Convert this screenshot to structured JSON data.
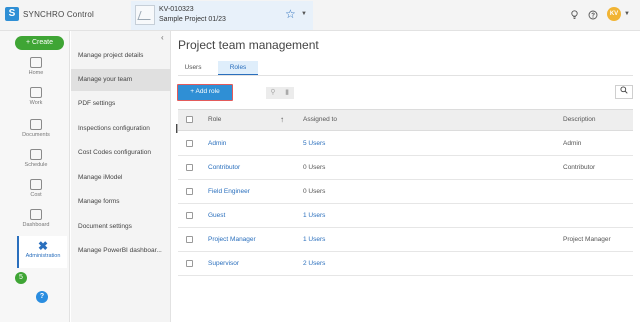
{
  "topbar": {
    "app_logo_glyph": "S",
    "app_title": "SYNCHRO Control",
    "project_code": "KV-010323",
    "project_name": "Sample Project 01/23",
    "favorite_icon": "star-outline-icon",
    "user_initials": "KV",
    "icons": [
      "lightbulb-icon",
      "help-circle-icon"
    ]
  },
  "leftrail": {
    "create_label": "+ Create",
    "items": [
      {
        "label": "Home",
        "icon": "home-icon"
      },
      {
        "label": "Work",
        "icon": "work-icon"
      },
      {
        "label": "Documents",
        "icon": "document-icon"
      },
      {
        "label": "Schedule",
        "icon": "schedule-icon"
      },
      {
        "label": "Cost",
        "icon": "cost-icon"
      },
      {
        "label": "Dashboard",
        "icon": "dashboard-icon"
      }
    ],
    "active_item": {
      "label": "Administration",
      "icon": "administration-icon"
    },
    "notification_count": "5",
    "help_label": "?"
  },
  "submenu": {
    "items": [
      "Manage project details",
      "Manage your team",
      "PDF settings",
      "Inspections configuration",
      "Cost Codes configuration",
      "Manage iModel",
      "Manage forms",
      "Document settings",
      "Manage PowerBI dashboar..."
    ],
    "active_index": 1
  },
  "main": {
    "title": "Project team management",
    "tabs": [
      {
        "label": "Users",
        "active": false
      },
      {
        "label": "Roles",
        "active": true
      }
    ],
    "add_role_label": "+ Add role",
    "columns": {
      "role": "Role",
      "assigned": "Assigned to",
      "description": "Description"
    },
    "rows": [
      {
        "role": "Admin",
        "assigned": "5 Users",
        "description": "Admin",
        "assigned_link": true
      },
      {
        "role": "Contributor",
        "assigned": "0 Users",
        "description": "Contributor",
        "assigned_link": false
      },
      {
        "role": "Field Engineer",
        "assigned": "0 Users",
        "description": "",
        "assigned_link": false
      },
      {
        "role": "Guest",
        "assigned": "1 Users",
        "description": "",
        "assigned_link": true
      },
      {
        "role": "Project Manager",
        "assigned": "1 Users",
        "description": "Project Manager",
        "assigned_link": true
      },
      {
        "role": "Supervisor",
        "assigned": "2 Users",
        "description": "",
        "assigned_link": true
      }
    ]
  },
  "colors": {
    "accent": "#2a6fbd",
    "create_green": "#3fa535",
    "add_button_blue": "#2f8fd5",
    "highlight_red": "#e35b5b"
  }
}
